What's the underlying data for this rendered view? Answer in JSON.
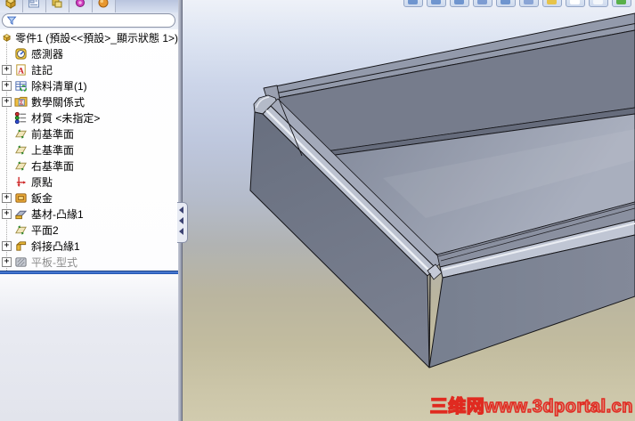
{
  "app": {
    "title": "SolidWorks part document"
  },
  "feature_manager": {
    "tabs": [
      {
        "name": "featuremanager-design-tree-tab",
        "icon": "icon-tab-feature"
      },
      {
        "name": "propertymanager-tab",
        "icon": "icon-tab-property"
      },
      {
        "name": "configurationmanager-tab",
        "icon": "icon-tab-config"
      },
      {
        "name": "dimxpertmanager-tab",
        "icon": "icon-tab-dimxpert"
      },
      {
        "name": "displaymanager-tab",
        "icon": "icon-tab-display"
      }
    ],
    "filter": {
      "placeholder": ""
    },
    "root_label": "零件1 (預設<<預設>_顯示狀態 1>)",
    "items": [
      {
        "label": "感測器",
        "icon": "icon-sensors",
        "name": "tree-item-sensors",
        "expandable": false,
        "suppressed": false
      },
      {
        "label": "註記",
        "icon": "icon-annotations",
        "name": "tree-item-annotations",
        "expandable": true,
        "suppressed": false
      },
      {
        "label": "除料清單(1)",
        "icon": "icon-cutlist",
        "name": "tree-item-cut-list",
        "expandable": true,
        "suppressed": false
      },
      {
        "label": "數學關係式",
        "icon": "icon-equations",
        "name": "tree-item-equations",
        "expandable": true,
        "suppressed": false
      },
      {
        "label": "材質 <未指定>",
        "icon": "icon-material",
        "name": "tree-item-material",
        "expandable": false,
        "suppressed": false
      },
      {
        "label": "前基準面",
        "icon": "icon-plane",
        "name": "tree-item-front-plane",
        "expandable": false,
        "suppressed": false
      },
      {
        "label": "上基準面",
        "icon": "icon-plane",
        "name": "tree-item-top-plane",
        "expandable": false,
        "suppressed": false
      },
      {
        "label": "右基準面",
        "icon": "icon-plane",
        "name": "tree-item-right-plane",
        "expandable": false,
        "suppressed": false
      },
      {
        "label": "原點",
        "icon": "icon-origin",
        "name": "tree-item-origin",
        "expandable": false,
        "suppressed": false
      },
      {
        "label": "鈑金",
        "icon": "icon-sheetmetal",
        "name": "tree-item-sheet-metal",
        "expandable": true,
        "suppressed": false
      },
      {
        "label": "基材-凸緣1",
        "icon": "icon-baseflange",
        "name": "tree-item-base-flange1",
        "expandable": true,
        "suppressed": false
      },
      {
        "label": "平面2",
        "icon": "icon-plane",
        "name": "tree-item-plane2",
        "expandable": false,
        "suppressed": false
      },
      {
        "label": "斜接凸緣1",
        "icon": "icon-miterflange",
        "name": "tree-item-miter-flange1",
        "expandable": true,
        "suppressed": false
      },
      {
        "label": "平板-型式",
        "icon": "icon-flatpattern",
        "name": "tree-item-flat-pattern",
        "expandable": true,
        "suppressed": true
      }
    ]
  },
  "viewport": {
    "watermark_text": "三维网www.3dportal.cn",
    "toolbar_icons": [
      {
        "name": "zoom-fit-icon",
        "tint": "#6f95cf"
      },
      {
        "name": "zoom-area-icon",
        "tint": "#6f95cf"
      },
      {
        "name": "previous-view-icon",
        "tint": "#6f95cf"
      },
      {
        "name": "section-view-icon",
        "tint": "#7d9cd2"
      },
      {
        "name": "view-orientation-icon",
        "tint": "#6f95cf"
      },
      {
        "name": "display-style-icon",
        "tint": "#8aa5d6"
      },
      {
        "name": "hide-show-items-icon",
        "tint": "#e6c34a"
      },
      {
        "name": "edit-appearance-icon",
        "tint": "#ffffff"
      },
      {
        "name": "apply-scene-icon",
        "tint": "#f4f7fb"
      },
      {
        "name": "view-settings-icon",
        "tint": "#58b04a"
      }
    ]
  },
  "colors": {
    "rollback_bar_blue": "#1c4fae",
    "watermark_red": "#e02a20",
    "model_gray_top": "#a3a9b9",
    "model_gray_dark": "#6d7384",
    "background_khaki": "#c2bc9f"
  }
}
